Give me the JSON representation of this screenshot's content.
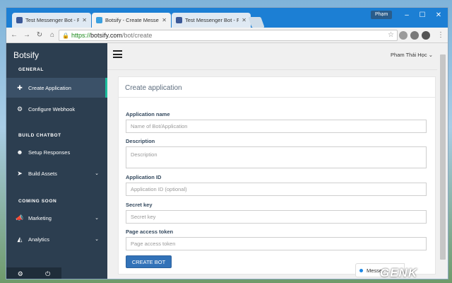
{
  "browser": {
    "tabs": [
      {
        "title": "Test Messenger Bot - Face",
        "active": false
      },
      {
        "title": "Botsify - Create Messeng",
        "active": true
      },
      {
        "title": "Test Messenger Bot - Face",
        "active": false
      }
    ],
    "profile_name": "Phạm",
    "url": {
      "scheme": "https://",
      "host": "botsify.com",
      "path": "/bot/create"
    }
  },
  "sidebar": {
    "brand": "Botsify",
    "sections": [
      {
        "title": "GENERAL",
        "items": [
          {
            "label": "Create Application",
            "icon": "plus-icon",
            "active": true,
            "has_chevron": false
          },
          {
            "label": "Configure Webhook",
            "icon": "webhook-icon",
            "active": false,
            "has_chevron": false
          }
        ]
      },
      {
        "title": "BUILD CHATBOT",
        "items": [
          {
            "label": "Setup Responses",
            "icon": "reddit-icon",
            "active": false,
            "has_chevron": false
          },
          {
            "label": "Build Assets",
            "icon": "send-icon",
            "active": false,
            "has_chevron": true
          }
        ]
      },
      {
        "title": "COMING SOON",
        "items": [
          {
            "label": "Marketing",
            "icon": "bullhorn-icon",
            "active": false,
            "has_chevron": true
          },
          {
            "label": "Analytics",
            "icon": "area-chart-icon",
            "active": false,
            "has_chevron": true
          }
        ]
      }
    ]
  },
  "topbar": {
    "user_name": "Pham Thái Học"
  },
  "panel": {
    "title": "Create application",
    "fields": {
      "app_name": {
        "label": "Application name",
        "placeholder": "Name of Bot/Application"
      },
      "description": {
        "label": "Description",
        "placeholder": "Description"
      },
      "app_id": {
        "label": "Application ID",
        "placeholder": "Application ID (optional)"
      },
      "secret": {
        "label": "Secret key",
        "placeholder": "Secret key"
      },
      "token": {
        "label": "Page access token",
        "placeholder": "Page access token"
      }
    },
    "submit_label": "CREATE BOT"
  },
  "messenger_widget": {
    "label": "Messer"
  },
  "watermark": "GENK"
}
